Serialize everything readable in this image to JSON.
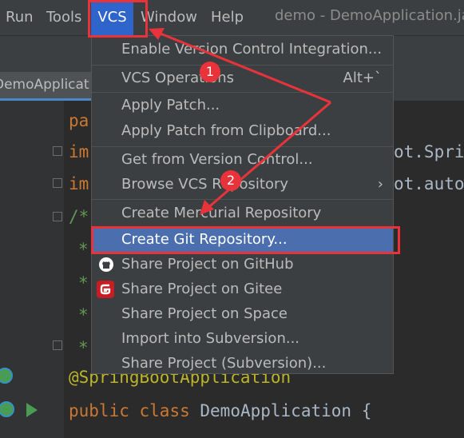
{
  "menubar": {
    "items": [
      {
        "label": "Run"
      },
      {
        "label": "Tools"
      },
      {
        "label": "VCS"
      },
      {
        "label": "Window"
      },
      {
        "label": "Help"
      }
    ],
    "window_title": "demo - DemoApplication.ja"
  },
  "editor": {
    "tab_label": "DemoApplicat",
    "lines": {
      "l1": "pa",
      "l2": "im",
      "l2_tail": "ot.Spri",
      "l3": "im",
      "l3_tail": "ot.auto",
      "l4": "/*",
      "l5": "*",
      "l6": "*",
      "l7": "*",
      "l8": "*",
      "annotation": "@SpringBootApplication",
      "class_kw1": "public",
      "class_kw2": "class",
      "class_name": "DemoApplication",
      "class_brace": "{"
    }
  },
  "vcs_menu": {
    "items": [
      {
        "label": "Enable Version Control Integration..."
      },
      {
        "label": "VCS Operations",
        "shortcut": "Alt+`"
      },
      {
        "label": "Apply Patch..."
      },
      {
        "label": "Apply Patch from Clipboard..."
      },
      {
        "label": "Get from Version Control..."
      },
      {
        "label": "Browse VCS Repository",
        "submenu_glyph": "›"
      },
      {
        "label": "Create Mercurial Repository"
      },
      {
        "label": "Create Git Repository..."
      },
      {
        "label": "Share Project on GitHub",
        "icon": "github-icon"
      },
      {
        "label": "Share Project on Gitee",
        "icon": "gitee-icon"
      },
      {
        "label": "Share Project on Space"
      },
      {
        "label": "Import into Subversion..."
      },
      {
        "label": "Share Project (Subversion)..."
      }
    ]
  },
  "annotations": {
    "badge1": "1",
    "badge2": "2",
    "color": "#e8333a"
  },
  "colors": {
    "menu_bg": "#3c3f41",
    "selection": "#4b6eaf",
    "active_menu": "#2f65ca",
    "editor_bg": "#2b2b2b"
  }
}
